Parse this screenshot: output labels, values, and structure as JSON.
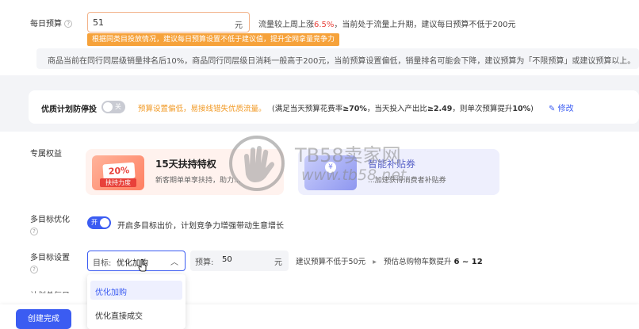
{
  "daily_budget": {
    "label": "每日预算",
    "help": "?",
    "value": "51",
    "unit": "元",
    "warning": "根据同类目投放情况，建议每日预算设置不低于建议值，提升全网拿量竞争力",
    "hint_prefix": "流量较上周上涨",
    "hint_percent": "6.5%",
    "hint_suffix": "，当前处于流量上升期，建议每日预算不低于200元",
    "info": "商品当前在同行同层级销量排名后10%，商品同行同层级日消耗一般高于200元，当前预算设置偏低，销量排名可能会下降，建议预算为「不限预算」或建议预算以上。"
  },
  "quality_stop": {
    "label": "优质计划防停投",
    "toggle_text": "关",
    "warning": "预算设置偏低，易接线错失优质流量。",
    "rule_a": "(满足当天预算花费率",
    "rule_b": "≥70%",
    "rule_c": "，当天投入产出比",
    "rule_d": "≥2.49",
    "rule_e": "，则单次预算提升",
    "rule_f": "10%",
    "rule_g": ")",
    "edit_label": "修改"
  },
  "benefits": {
    "label": "专属权益",
    "items": [
      {
        "badge_pct": "20%",
        "badge_label": "扶持力度",
        "title": "15天扶持特权",
        "desc": "新客期单单享扶持，助力..."
      },
      {
        "badge_symbol": "¥",
        "title": "智能补贴券",
        "desc": "...加速获得消费者补贴券"
      }
    ]
  },
  "multi_opt": {
    "label": "多目标优化",
    "help": "?",
    "toggle_text": "开",
    "desc": "开启多目标出价，计划竞争力增强带动生意增长"
  },
  "multi_setting": {
    "label": "多目标设置",
    "help": "?",
    "select_prefix": "目标:",
    "select_value": "优化加购",
    "budget_prefix": "预算:",
    "budget_value": "50",
    "budget_unit": "元",
    "hint": "建议预算不低于50元",
    "arrow": "▸",
    "est_prefix": "预估总购物车数提升",
    "est_value": "6 ~ 12",
    "options": [
      "优化加购",
      "优化直接成交"
    ]
  },
  "plan_label_partial": "计划总每日",
  "footer": {
    "create_label": "创建完成"
  },
  "watermark": {
    "title": "TB58卖家网",
    "url": "www.tb58.net"
  },
  "colors": {
    "accent": "#3b5cf2",
    "warn": "#f19a26",
    "red": "#e8413a"
  }
}
